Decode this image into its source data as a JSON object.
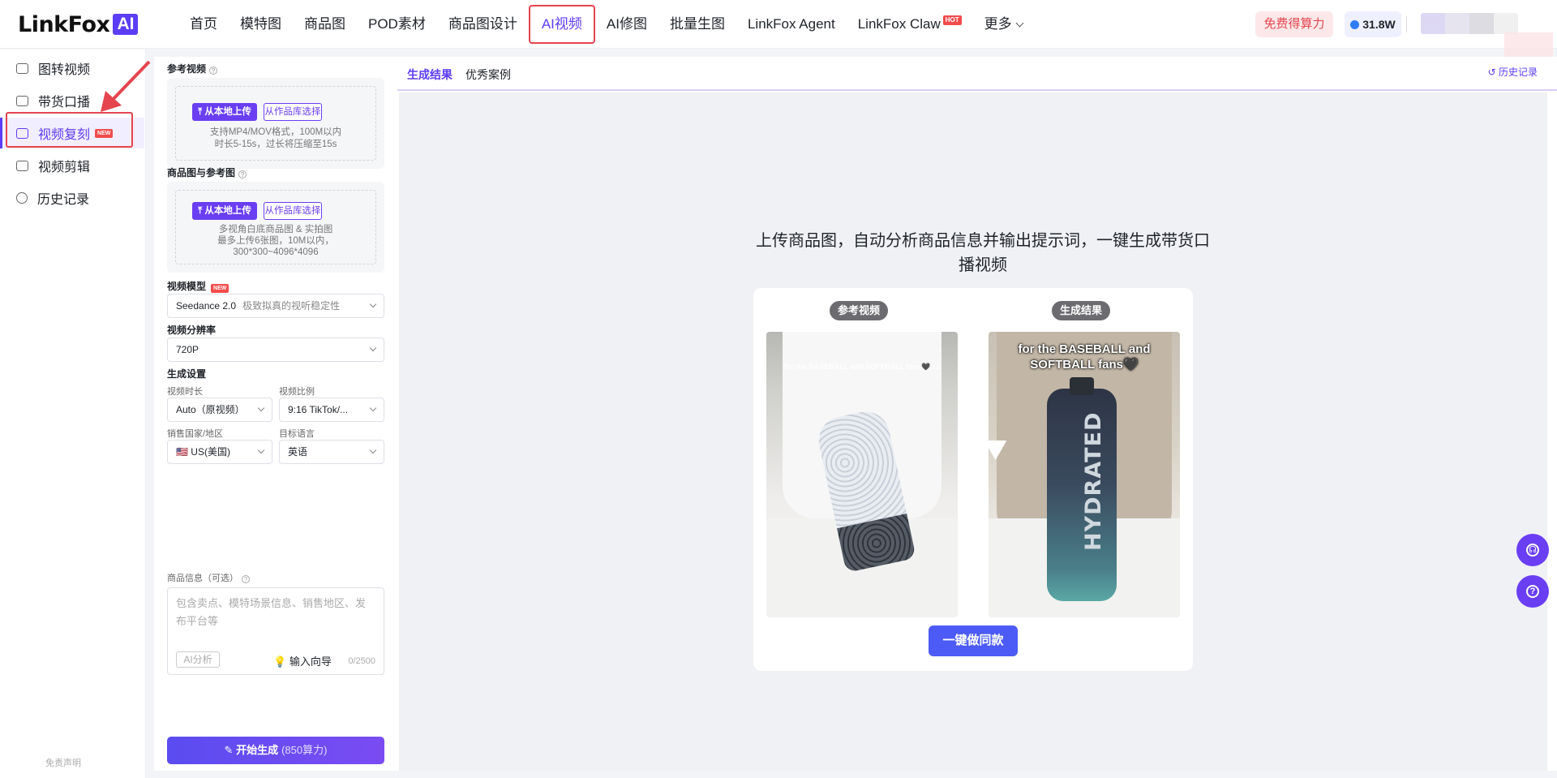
{
  "brand": {
    "name": "LinkFox",
    "badge": "AI"
  },
  "nav": {
    "items": [
      "首页",
      "模特图",
      "商品图",
      "POD素材",
      "商品图设计",
      "AI视频",
      "AI修图",
      "批量生图",
      "LinkFox Agent",
      "LinkFox Claw",
      "更多"
    ],
    "active_index": 5,
    "hot_label": "HOT"
  },
  "header": {
    "free_compute": "免费得算力",
    "credits": "31.8W"
  },
  "sidebar": {
    "items": [
      {
        "label": "图转视频"
      },
      {
        "label": "带货口播"
      },
      {
        "label": "视频复刻",
        "badge": "NEW"
      },
      {
        "label": "视频剪辑"
      },
      {
        "label": "历史记录"
      }
    ],
    "active_index": 2,
    "disclaimer": "免责声明"
  },
  "panel": {
    "ref_video": {
      "label": "参考视频",
      "upload_local": "从本地上传",
      "from_library": "从作品库选择",
      "hint1": "支持MP4/MOV格式，100M以内",
      "hint2": "时长5-15s，过长将压缩至15s"
    },
    "product_images": {
      "label": "商品图与参考图",
      "upload_local": "从本地上传",
      "from_library": "从作品库选择",
      "hint1": "多视角白底商品图 & 实拍图",
      "hint2": "最多上传6张图，10M以内，",
      "hint3": "300*300~4096*4096"
    },
    "video_model": {
      "label": "视频模型",
      "badge": "NEW",
      "value": "Seedance 2.0",
      "desc": "极致拟真的视听稳定性"
    },
    "resolution": {
      "label": "视频分辨率",
      "value": "720P"
    },
    "gen_settings": {
      "label": "生成设置",
      "duration_label": "视频时长",
      "duration_value": "Auto（原视频）",
      "ratio_label": "视频比例",
      "ratio_value": "9:16 TikTok/...",
      "region_label": "销售国家/地区",
      "region_value": "🇺🇸 US(美国)",
      "language_label": "目标语言",
      "language_value": "英语"
    },
    "product_info": {
      "label": "商品信息（可选）",
      "placeholder": "包含卖点、模特场景信息、销售地区、发布平台等",
      "ai_analyze": "AI分析",
      "guide": "输入向导",
      "count": "0/2500"
    },
    "generate": {
      "label": "开始生成",
      "cost": "(850算力)"
    }
  },
  "main": {
    "tabs": [
      "生成结果",
      "优秀案例"
    ],
    "active_tab": 0,
    "history": "历史记录",
    "headline": "上传商品图，自动分析商品信息并输出提示词，一键生成带货口播视频",
    "ref_pill": "参考视频",
    "result_pill": "生成结果",
    "ref_caption": "for the BASEBALL and SOFTBALL fans🖤NZ",
    "result_caption": "for the BASEBALL and SOFTBALL fans🖤",
    "bottle_text": "HYDRATED",
    "make_same": "一键做同款"
  },
  "colors": {
    "accent": "#5b3df5",
    "highlight": "#e5454f"
  }
}
